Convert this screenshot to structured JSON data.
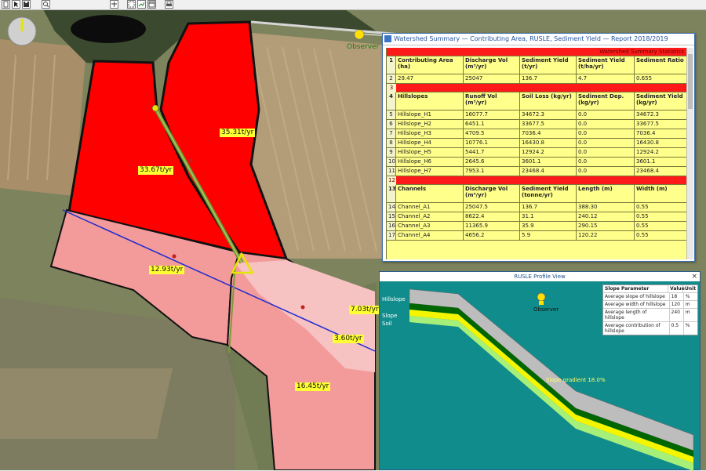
{
  "toolbar": {
    "buttons": [
      "new-doc-icon",
      "pointer-icon",
      "save-icon",
      "zoom-tool-icon",
      "pan-tool-icon",
      "select-tool-icon",
      "measure-tool-icon",
      "window-icon",
      "print-icon"
    ]
  },
  "map": {
    "observer_label": "Observer",
    "compass_label": "N",
    "flow_labels": {
      "upper_center": "35.31t/yr",
      "upper_left": "33.67t/yr",
      "middle": "12.93t/yr",
      "right_small_1": "7.03t/yr",
      "right_small_2": "3.60t/yr",
      "bottom": "16.45t/yr"
    },
    "colors": {
      "red_field": "#ff0000",
      "pink_field": "#f39a9a",
      "light_pink_field": "#f7c2c2",
      "channel_green": "#7da33a",
      "transect_blue": "#1e2bd0"
    }
  },
  "table_window": {
    "title": "Watershed Summary — Contributing Area, RUSLE, Sediment Yield — Report 2018/2019",
    "top_banner": "Watershed Summary Statistics",
    "rows": [
      {
        "n": "1",
        "cells": [
          "Contributing Area (ha)",
          "Discharge Vol (m³/yr)",
          "Sediment Yield (t/yr)",
          "Sediment Yield (t/ha/yr)",
          "Sediment Ratio"
        ],
        "type": "hdr"
      },
      {
        "n": "2",
        "cells": [
          "29.47",
          "25047",
          "136.7",
          "4.7",
          "0.655"
        ],
        "type": "data"
      },
      {
        "n": "3",
        "cells": [
          "",
          "",
          "",
          "",
          ""
        ],
        "type": "red"
      },
      {
        "n": "4",
        "cells": [
          "Hillslopes",
          "Runoff Vol (m³/yr)",
          "Soil Loss (kg/yr)",
          "Sediment Dep. (kg/yr)",
          "Sediment Yield (kg/yr)"
        ],
        "type": "hdr"
      },
      {
        "n": "5",
        "cells": [
          "Hillslope_H1",
          "16077.7",
          "34672.3",
          "0.0",
          "34672.3"
        ],
        "type": "data"
      },
      {
        "n": "6",
        "cells": [
          "Hillslope_H2",
          "6451.1",
          "33677.5",
          "0.0",
          "33677.5"
        ],
        "type": "data"
      },
      {
        "n": "7",
        "cells": [
          "Hillslope_H3",
          "4709.5",
          "7036.4",
          "0.0",
          "7036.4"
        ],
        "type": "data"
      },
      {
        "n": "8",
        "cells": [
          "Hillslope_H4",
          "10776.1",
          "16430.8",
          "0.0",
          "16430.8"
        ],
        "type": "data"
      },
      {
        "n": "9",
        "cells": [
          "Hillslope_H5",
          "5441.7",
          "12924.2",
          "0.0",
          "12924.2"
        ],
        "type": "data"
      },
      {
        "n": "10",
        "cells": [
          "Hillslope_H6",
          "2645.6",
          "3601.1",
          "0.0",
          "3601.1"
        ],
        "type": "data"
      },
      {
        "n": "11",
        "cells": [
          "Hillslope_H7",
          "7953.1",
          "23468.4",
          "0.0",
          "23468.4"
        ],
        "type": "data"
      },
      {
        "n": "12",
        "cells": [
          "",
          "",
          "",
          "",
          ""
        ],
        "type": "red"
      },
      {
        "n": "13",
        "cells": [
          "Channels",
          "Discharge Vol (m³/yr)",
          "Sediment Yield (tonne/yr)",
          "Length (m)",
          "Width (m)"
        ],
        "type": "hdr"
      },
      {
        "n": "14",
        "cells": [
          "Channel_A1",
          "25047.5",
          "136.7",
          "388.30",
          "0.55"
        ],
        "type": "data"
      },
      {
        "n": "15",
        "cells": [
          "Channel_A2",
          "8622.4",
          "31.1",
          "240.12",
          "0.55"
        ],
        "type": "data"
      },
      {
        "n": "16",
        "cells": [
          "Channel_A3",
          "11365.9",
          "35.9",
          "290.15",
          "0.55"
        ],
        "type": "data"
      },
      {
        "n": "17",
        "cells": [
          "Channel_A4",
          "4656.2",
          "5.9",
          "120.22",
          "0.55"
        ],
        "type": "data"
      }
    ]
  },
  "profile_window": {
    "title": "RUSLE Profile View",
    "observer_label": "Observer",
    "layer_labels": [
      "Hillslope",
      "Slope",
      "Soil"
    ],
    "slope_annotation": "Slope gradient 18.0%",
    "legend": [
      {
        "name": "Slope Parameter",
        "value": "Value",
        "unit": "Unit"
      },
      {
        "name": "Average slope of hillslope",
        "value": "18",
        "unit": "%"
      },
      {
        "name": "Average width of hillslope",
        "value": "120",
        "unit": "m"
      },
      {
        "name": "Average length of hillslope",
        "value": "240",
        "unit": "m"
      },
      {
        "name": "Average contribution of hillslope",
        "value": "0.5",
        "unit": "%"
      }
    ],
    "close_glyph": "×"
  }
}
